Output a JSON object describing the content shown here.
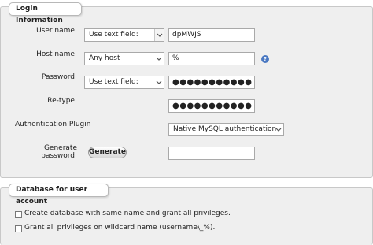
{
  "login_section": {
    "legend": "Login Information",
    "user_name": {
      "label": "User name:",
      "mode": "Use text field:",
      "value": "dpMWJS"
    },
    "host_name": {
      "label": "Host name:",
      "mode": "Any host",
      "value": "%",
      "help_icon": "help-circle-icon"
    },
    "password": {
      "label": "Password:",
      "mode": "Use text field:",
      "value": "●●●●●●●●●●●"
    },
    "retype": {
      "label": "Re-type:",
      "value": "●●●●●●●●●●●"
    },
    "auth_plugin": {
      "label": "Authentication Plugin",
      "value": "Native MySQL authentication"
    },
    "generate_password": {
      "label": "Generate password:",
      "button": "Generate",
      "value": ""
    }
  },
  "database_section": {
    "legend": "Database for user account",
    "options": [
      "Create database with same name and grant all privileges.",
      "Grant all privileges on wildcard name (username\\_%)."
    ]
  },
  "colors": {
    "fieldset_bg": "#efefef",
    "help_icon": "#4a78c2"
  }
}
